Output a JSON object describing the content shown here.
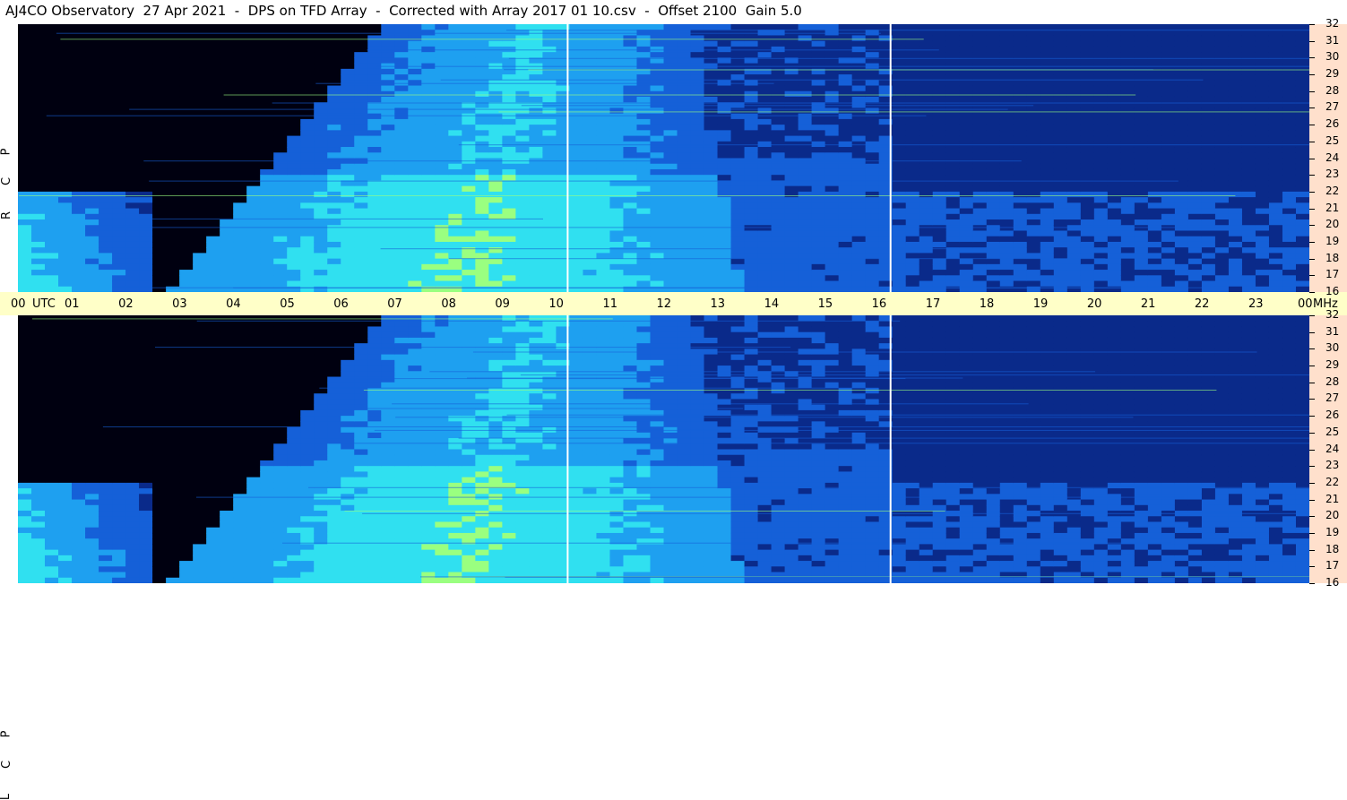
{
  "title": "AJ4CO Observatory  27 Apr 2021  -  DPS on TFD Array  -  Corrected with Array 2017 01 10.csv  -  Offset 2100  Gain 5.0",
  "chart_data": {
    "type": "heatmap",
    "title": "AJ4CO Observatory  27 Apr 2021  -  DPS on TFD Array  -  Corrected with Array 2017 01 10.csv  -  Offset 2100  Gain 5.0",
    "xlabel": "UTC",
    "ylabel": "MHz",
    "x_ticks": [
      "00",
      "01",
      "02",
      "03",
      "04",
      "05",
      "06",
      "07",
      "08",
      "09",
      "10",
      "11",
      "12",
      "13",
      "14",
      "15",
      "16",
      "17",
      "18",
      "19",
      "20",
      "21",
      "22",
      "23",
      "00"
    ],
    "x_range_hours": [
      0,
      24
    ],
    "y_ticks": [
      "16",
      "17",
      "18",
      "19",
      "20",
      "21",
      "22",
      "23",
      "24",
      "25",
      "26",
      "27",
      "28",
      "29",
      "30",
      "31",
      "32"
    ],
    "y_range_mhz": [
      16,
      32
    ],
    "panels": [
      {
        "name": "RCP",
        "letters": [
          "R",
          "C",
          "P"
        ]
      },
      {
        "name": "LCP",
        "letters": [
          "L",
          "C",
          "P"
        ]
      }
    ],
    "color_scale": [
      "#000010",
      "#0a2a8a",
      "#1560d8",
      "#1ea0f0",
      "#30e0f0",
      "#9aff80",
      "#ffff40",
      "#ff4040"
    ],
    "vertical_markers_hours": [
      10.2,
      16.2
    ]
  },
  "labels": {
    "utc_label": "UTC",
    "mhz_label": "MHz"
  }
}
